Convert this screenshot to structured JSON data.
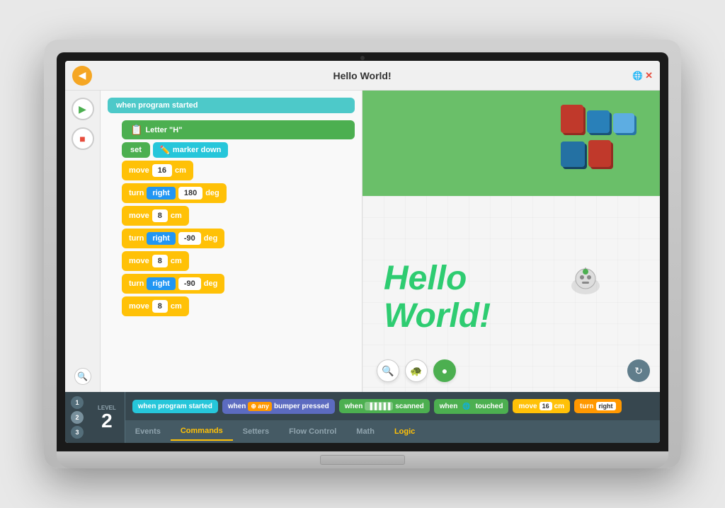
{
  "header": {
    "title": "Hello World!",
    "back_label": "◀",
    "close_label": "✕"
  },
  "blocks": {
    "start": "when program started",
    "letter": "Letter \"H\"",
    "set_marker": "set",
    "marker_down": "marker down",
    "rows": [
      {
        "type": "move",
        "label": "move",
        "value1": "16",
        "unit": "cm"
      },
      {
        "type": "turn",
        "label": "turn",
        "dir": "right",
        "value1": "180",
        "unit": "deg"
      },
      {
        "type": "move",
        "label": "move",
        "value1": "8",
        "unit": "cm"
      },
      {
        "type": "turn",
        "label": "turn",
        "dir": "right",
        "value1": "-90",
        "unit": "deg"
      },
      {
        "type": "move",
        "label": "move",
        "value1": "8",
        "unit": "cm"
      },
      {
        "type": "turn",
        "label": "turn",
        "dir": "right",
        "value1": "-90",
        "unit": "deg"
      },
      {
        "type": "move",
        "label": "move",
        "value1": "8",
        "unit": "cm"
      }
    ]
  },
  "view": {
    "hello_text_line1": "Hello",
    "hello_text_line2": "World!"
  },
  "toolbar": {
    "blocks": [
      {
        "label": "when program started",
        "type": "teal"
      },
      {
        "label": "when",
        "badge": "any",
        "suffix": "bumper pressed",
        "type": "blue"
      },
      {
        "label": "when",
        "badge": "||||",
        "suffix": "scanned",
        "type": "green"
      },
      {
        "label": "when",
        "badge": "🌐",
        "suffix": "touched",
        "type": "green"
      },
      {
        "label": "move",
        "value": "16",
        "unit": "cm",
        "type": "yellow"
      },
      {
        "label": "turn",
        "dir": "right",
        "type": "orange"
      }
    ]
  },
  "categories": [
    {
      "label": "Events",
      "active": false
    },
    {
      "label": "Commands",
      "active": true
    },
    {
      "label": "Setters",
      "active": false
    },
    {
      "label": "Flow Control",
      "active": false
    },
    {
      "label": "Math",
      "active": false
    },
    {
      "label": "Logic",
      "active": false,
      "color": "yellow"
    }
  ],
  "level": {
    "label": "LEVEL",
    "number": "2",
    "dots": [
      "1",
      "2",
      "3"
    ]
  }
}
